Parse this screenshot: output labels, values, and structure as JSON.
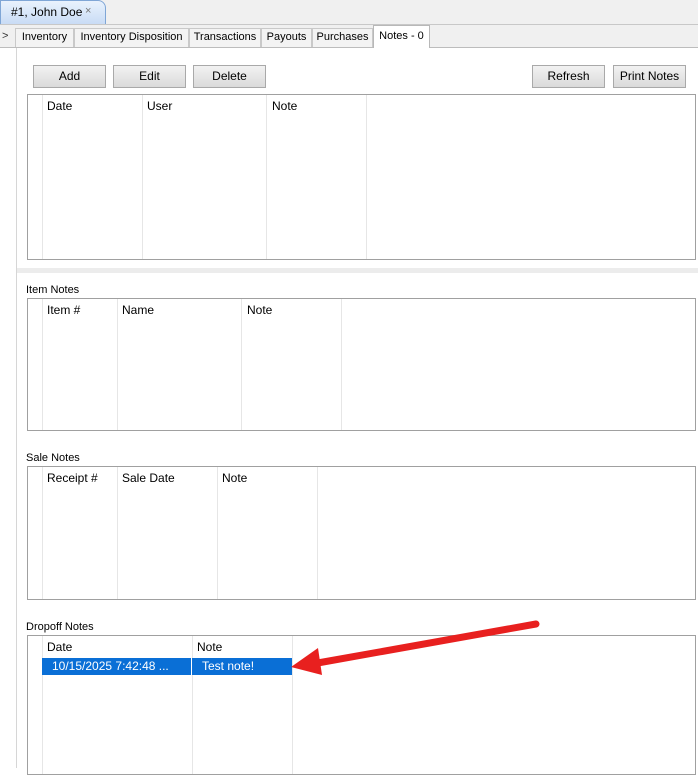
{
  "doc_tab": {
    "label": "#1, John Doe",
    "close": "×"
  },
  "subtabs": {
    "chevron": ">",
    "items": [
      "Inventory",
      "Inventory Disposition",
      "Transactions",
      "Payouts",
      "Purchases",
      "Notes - 0"
    ]
  },
  "toolbar": {
    "add": "Add",
    "edit": "Edit",
    "delete": "Delete",
    "refresh": "Refresh",
    "print": "Print Notes"
  },
  "notes_grid": {
    "columns": [
      "Date",
      "User",
      "Note"
    ]
  },
  "item_notes": {
    "title": "Item Notes",
    "columns": [
      "Item #",
      "Name",
      "Note"
    ]
  },
  "sale_notes": {
    "title": "Sale Notes",
    "columns": [
      "Receipt #",
      "Sale Date",
      "Note"
    ]
  },
  "dropoff_notes": {
    "title": "Dropoff Notes",
    "columns": [
      "Date",
      "Note"
    ],
    "rows": [
      {
        "date": "10/15/2025 7:42:48 ...",
        "note": "Test note!"
      }
    ]
  },
  "colors": {
    "selection": "#0a6fd6",
    "arrow": "#e8201f",
    "tab_active": "#c9dcf5"
  }
}
